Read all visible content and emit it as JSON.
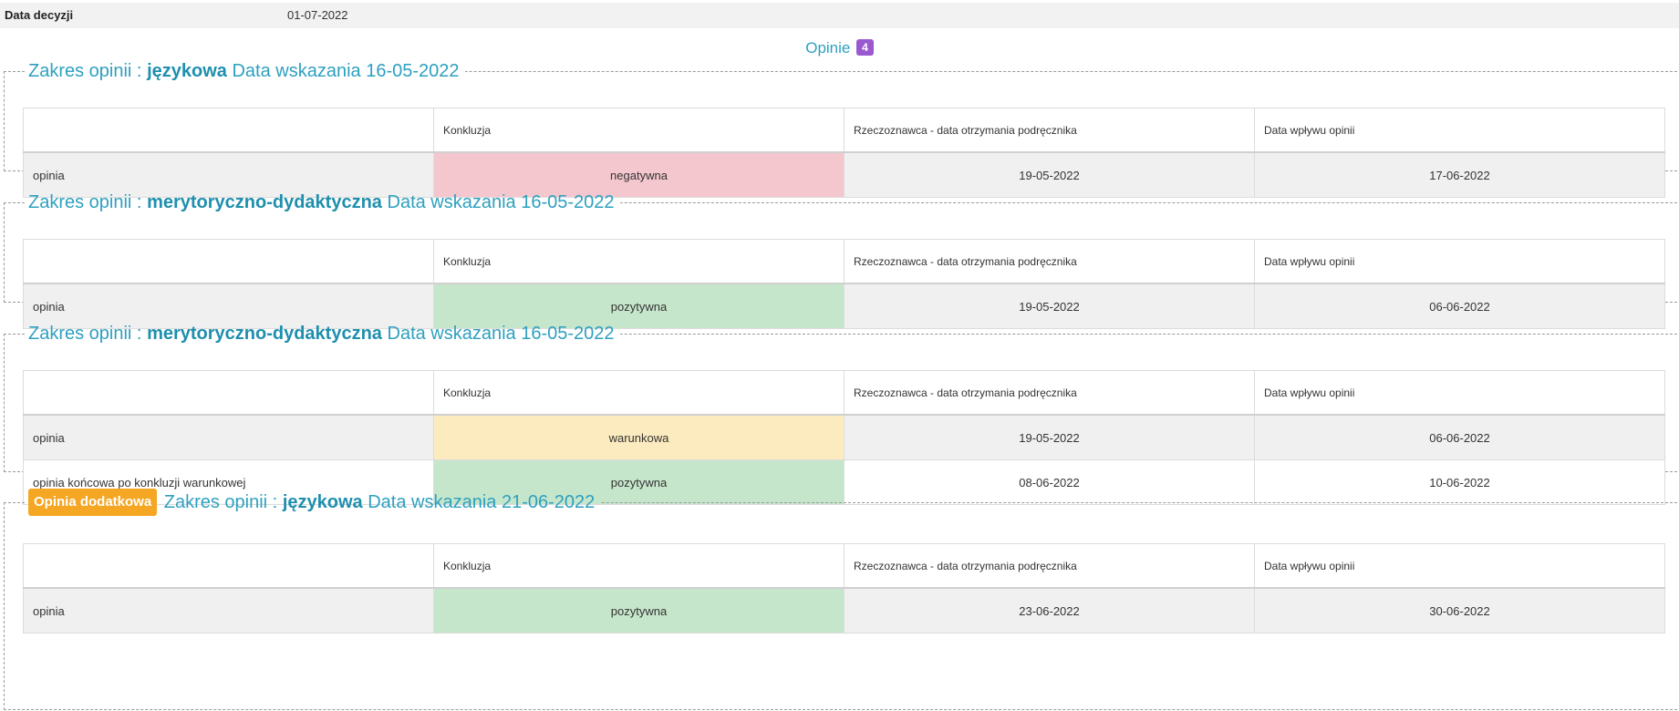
{
  "decision": {
    "label": "Data decyzji",
    "value": "01-07-2022"
  },
  "opinie": {
    "label": "Opinie",
    "count": "4"
  },
  "columns": {
    "conclusion": "Konkluzja",
    "reviewer_date": "Rzeczoznawca - data otrzymania podręcznika",
    "arrival_date": "Data wpływu opinii"
  },
  "sections": [
    {
      "prefix": "Zakres opinii :",
      "scope": "językowa",
      "date_text": "Data wskazania 16-05-2022",
      "rows": [
        {
          "label": "opinia",
          "conclusion": "negatywna",
          "reviewer_date": "19-05-2022",
          "arrival_date": "17-06-2022"
        }
      ]
    },
    {
      "prefix": "Zakres opinii :",
      "scope": "merytoryczno-dydaktyczna",
      "date_text": "Data wskazania 16-05-2022",
      "rows": [
        {
          "label": "opinia",
          "conclusion": "pozytywna",
          "reviewer_date": "19-05-2022",
          "arrival_date": "06-06-2022"
        }
      ]
    },
    {
      "prefix": "Zakres opinii :",
      "scope": "merytoryczno-dydaktyczna",
      "date_text": "Data wskazania 16-05-2022",
      "rows": [
        {
          "label": "opinia",
          "conclusion": "warunkowa",
          "reviewer_date": "19-05-2022",
          "arrival_date": "06-06-2022"
        },
        {
          "label": "opinia końcowa po konkluzji warunkowej",
          "conclusion": "pozytywna",
          "reviewer_date": "08-06-2022",
          "arrival_date": "10-06-2022"
        }
      ]
    },
    {
      "badge": "Opinia dodatkowa",
      "prefix": "Zakres opinii :",
      "scope": "językowa",
      "date_text": "Data wskazania 21-06-2022",
      "rows": [
        {
          "label": "opinia",
          "conclusion": "pozytywna",
          "reviewer_date": "23-06-2022",
          "arrival_date": "30-06-2022"
        }
      ]
    }
  ],
  "colors": {
    "accent": "#2ea0bf",
    "count_badge": "#9b59d0",
    "extra_badge": "#f5a623",
    "negative": "#f4c6cd",
    "positive": "#c6e6cb",
    "conditional": "#fcebbe"
  }
}
